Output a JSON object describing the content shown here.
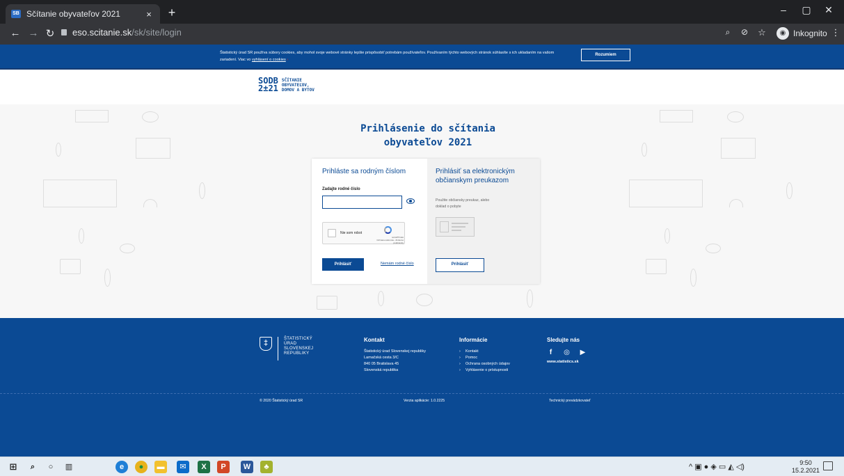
{
  "browser": {
    "tab_title": "Sčítanie obyvateľov 2021",
    "tab_close": "×",
    "new_tab": "+",
    "url_host": "eso.scitanie.sk",
    "url_path": "/sk/site/login",
    "profile_label": "Inkognito",
    "window_minimize": "–",
    "window_maximize": "▢",
    "window_close": "✕"
  },
  "cookie_bar": {
    "text": "Štatistický úrad SR používa súbory cookies, aby mohol svoje webové stránky lepšie prispôsobiť potrebám používateľov. Používaním týchto webových stránok súhlasíte s ich ukladaním na vašom zariadení. Viac vo",
    "link": "vyhlásení o cookies",
    "accept_label": "Rozumiem"
  },
  "header": {
    "logo_mark_top": "SODB",
    "logo_mark_bottom": "2±21",
    "logo_line1": "SČÍTANIE",
    "logo_line2": "OBYVATEĽOV,",
    "logo_line3": "DOMOV A BYTOV"
  },
  "login": {
    "title_line1": "Prihlásenie do sčítania",
    "title_line2": "obyvateľov 2021",
    "rc_heading": "Prihláste sa rodným číslom",
    "rc_label": "Zadajte rodné číslo",
    "rc_value": "",
    "captcha_label": "Nie som robot",
    "captcha_brand": "reCAPTCHA",
    "captcha_terms": "Ochrana súkromia - Zmluvné podmienky",
    "rc_submit": "Prihlásiť",
    "no_rc_link": "Nemám rodné číslo",
    "eid_heading": "Prihlásiť sa elektronickým občianskym preukazom",
    "eid_hint": "Použite občiansky preukaz, alebo doklad o pobyte",
    "eid_submit": "Prihlásiť"
  },
  "footer": {
    "org_line1": "ŠTATISTICKÝ",
    "org_line2": "ÚRAD",
    "org_line3": "SLOVENSKEJ",
    "org_line4": "REPUBLIKY",
    "contact_title": "Kontakt",
    "contact_lines": [
      "Štatistický úrad Slovenskej republiky",
      "Lamačská cesta 3/C",
      "840 05 Bratislava 45",
      "Slovenská republika"
    ],
    "info_title": "Informácie",
    "info_links": [
      "Kontakt",
      "Pomoc",
      "Ochrana osobných údajov",
      "Vyhlásenie o prístupnosti"
    ],
    "follow_title": "Sledujte nás",
    "website": "www.statistics.sk",
    "copyright": "© 2020 Štatistický úrad SR",
    "version": "Verzia aplikácie: 1.0.2225",
    "operator": "Technický prevádzkovateľ"
  },
  "taskbar": {
    "time": "9:50",
    "date": "15.2.2021"
  }
}
